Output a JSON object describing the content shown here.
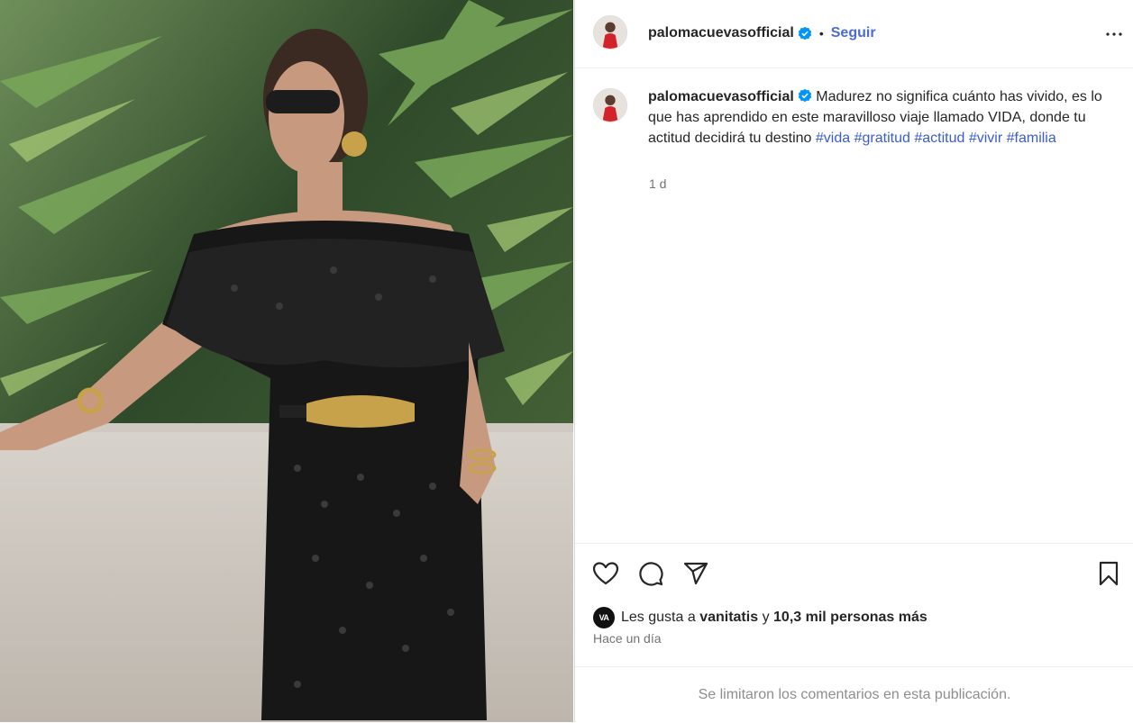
{
  "post": {
    "username": "palomacuevasofficial",
    "separator": "•",
    "follow_label": "Seguir",
    "more_label": "...",
    "caption_text": "Madurez no significa cuánto has vivido, es lo que has aprendido en este maravilloso viaje llamado VIDA, donde tu actitud decidirá tu destino",
    "hashtags": [
      "#vida",
      "#gratitud",
      "#actitud",
      "#vivir",
      "#familia"
    ],
    "caption_time": "1 d",
    "likes_avatar_label": "VA",
    "likes_prefix": "Les gusta a",
    "likes_user": "vanitatis",
    "likes_and": "y",
    "likes_others": "10,3 mil personas más",
    "posted_time": "Hace un día",
    "comments_disabled_text": "Se limitaron los comentarios en esta publicación."
  },
  "icons": {
    "verified": "verified-badge-icon",
    "like": "heart-icon",
    "comment": "comment-icon",
    "share": "share-icon",
    "save": "bookmark-icon",
    "more": "more-options-icon"
  },
  "colors": {
    "accent": "#0095f6",
    "hashtag": "#3a5ccf",
    "muted": "#737373"
  }
}
